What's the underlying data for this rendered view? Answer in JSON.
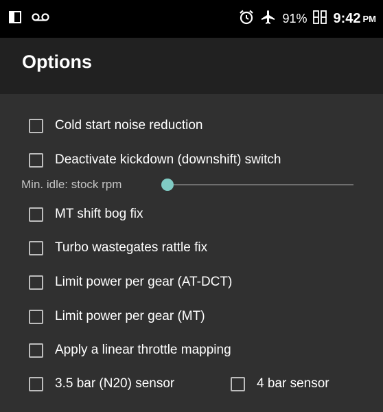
{
  "status_bar": {
    "icons": [
      "dual-screen-icon",
      "voicemail-icon",
      "alarm-icon",
      "airplane-mode-icon",
      "battery-icon"
    ],
    "battery": "91%",
    "time": "9:42",
    "ampm": "PM"
  },
  "app_bar": {
    "title": "Options"
  },
  "options": [
    {
      "label": "Cold start noise reduction",
      "checked": false
    },
    {
      "label": "Deactivate kickdown (downshift) switch",
      "checked": false
    },
    {
      "label": "MT shift bog fix",
      "checked": false
    },
    {
      "label": "Turbo wastegates rattle fix",
      "checked": false
    },
    {
      "label": "Limit power per gear (AT-DCT)",
      "checked": false
    },
    {
      "label": "Limit power per gear (MT)",
      "checked": false
    },
    {
      "label": "Apply a linear throttle mapping",
      "checked": false
    },
    {
      "label": "3.5 bar (N20) sensor",
      "checked": false
    },
    {
      "label": "4 bar sensor",
      "checked": false
    }
  ],
  "min_idle": {
    "label": "Min. idle: stock rpm",
    "value_fraction": 0
  },
  "colors": {
    "status_bar_bg": "#000000",
    "app_bar_bg": "#212121",
    "content_bg": "#303030",
    "accent": "#80cbc4",
    "checkbox_border": "#bdbdbd"
  }
}
